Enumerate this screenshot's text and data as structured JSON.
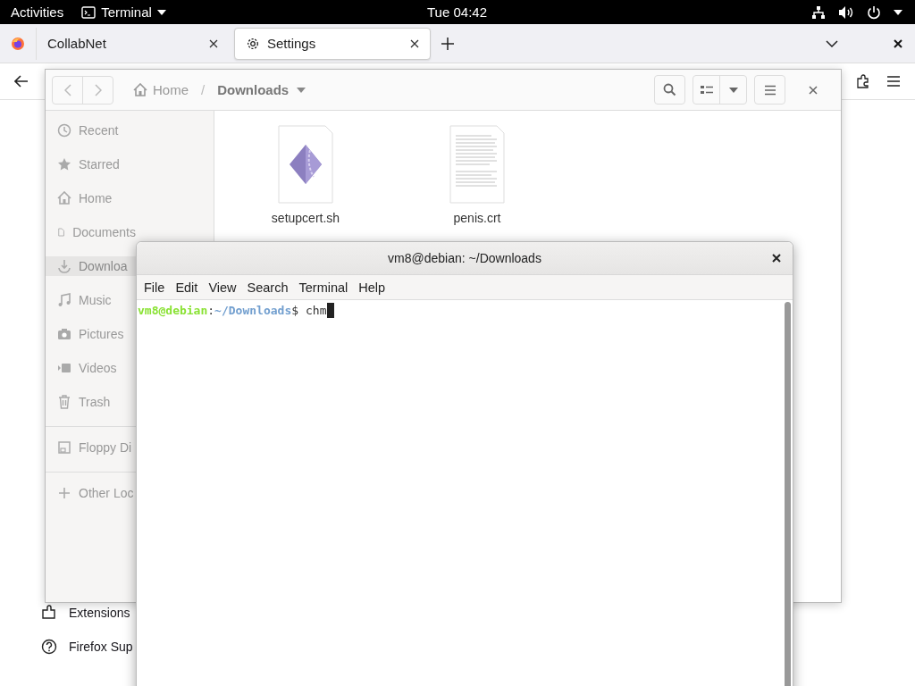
{
  "top_bar": {
    "activities": "Activities",
    "app_menu": "Terminal",
    "clock": "Tue 04:42"
  },
  "browser": {
    "tabs": [
      {
        "label": "CollabNet",
        "selected": false
      },
      {
        "label": "Settings",
        "selected": true
      }
    ],
    "page_items": [
      {
        "label": "Extensions",
        "kind": "extension"
      },
      {
        "label": "Firefox Sup",
        "kind": "help"
      }
    ]
  },
  "files": {
    "path": [
      {
        "label": "Home",
        "kind": "home"
      },
      {
        "label": "/",
        "kind": "separator"
      },
      {
        "label": "Downloads",
        "kind": "current"
      }
    ],
    "sidebar": [
      {
        "items": [
          {
            "label": "Recent",
            "kind": "recent",
            "selected": false
          },
          {
            "label": "Starred",
            "kind": "star",
            "selected": false
          },
          {
            "label": "Home",
            "kind": "home",
            "selected": false
          },
          {
            "label": "Documents",
            "kind": "document",
            "selected": false
          },
          {
            "label": "Downloa",
            "kind": "download",
            "selected": true
          },
          {
            "label": "Music",
            "kind": "music",
            "selected": false
          },
          {
            "label": "Pictures",
            "kind": "camera",
            "selected": false
          },
          {
            "label": "Videos",
            "kind": "video",
            "selected": false
          },
          {
            "label": "Trash",
            "kind": "trash",
            "selected": false
          }
        ]
      },
      {
        "items": [
          {
            "label": "Floppy Di",
            "kind": "floppy",
            "selected": false
          }
        ]
      },
      {
        "items": [
          {
            "label": "Other Loc",
            "kind": "plus",
            "selected": false
          }
        ]
      }
    ],
    "entries": [
      {
        "name": "setupcert.sh",
        "kind": "script"
      },
      {
        "name": "penis.crt",
        "kind": "text"
      }
    ]
  },
  "terminal": {
    "title": "vm8@debian: ~/Downloads",
    "menu": [
      "File",
      "Edit",
      "View",
      "Search",
      "Terminal",
      "Help"
    ],
    "prompt": {
      "user_host": "vm8@debian",
      "separator": ":",
      "path": "~/Downloads",
      "symbol": "$",
      "command": "chm"
    }
  }
}
